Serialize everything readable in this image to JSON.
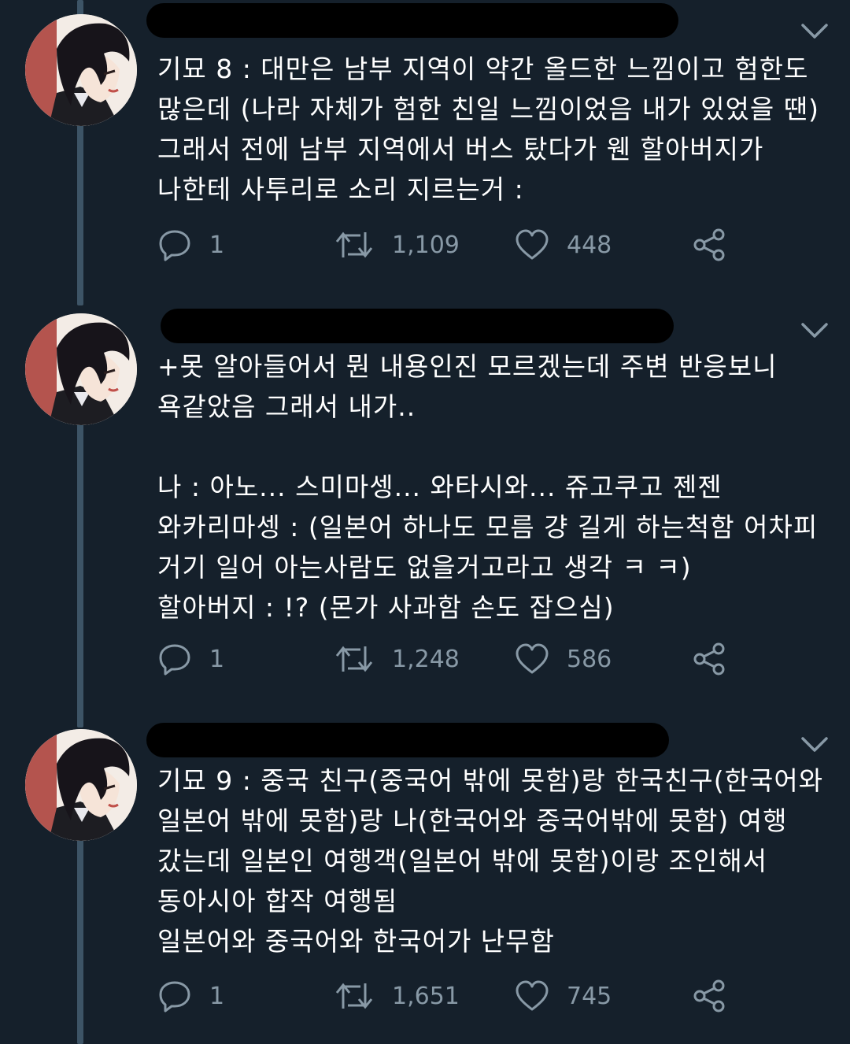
{
  "tweets": [
    {
      "text": "기묘 8 : 대만은 남부 지역이 약간 올드한 느낌이고 험한도\n많은데 (나라 자체가 험한 친일 느낌이었음 내가 있었을 땐)\n그래서 전에 남부 지역에서 버스 탔다가 웬 할아버지가\n나한테 사투리로 소리 지르는거 :",
      "replies": "1",
      "retweets": "1,109",
      "likes": "448"
    },
    {
      "text": "+못 알아들어서 뭔 내용인진 모르겠는데 주변 반응보니\n욕같았음 그래서 내가..\n\n나 : 아노... 스미마셍... 와타시와... 쥬고쿠고 젠젠\n와카리마셍 : (일본어 하나도 모름 걍 길게 하는척함 어차피\n거기 일어 아는사람도 없을거고라고 생각 ㅋ ㅋ)\n할아버지 : !? (몬가 사과함 손도 잡으심)",
      "replies": "1",
      "retweets": "1,248",
      "likes": "586"
    },
    {
      "text": "기묘 9 : 중국 친구(중국어 밖에 못함)랑 한국친구(한국어와\n일본어 밖에 못함)랑 나(한국어와 중국어밖에 못함) 여행\n갔는데 일본인 여행객(일본어 밖에 못함)이랑 조인해서\n동아시아 합작 여행됨\n일본어와 중국어와 한국어가 난무함",
      "replies": "1",
      "retweets": "1,651",
      "likes": "745"
    }
  ],
  "icons": {
    "reply": "speech-bubble-icon",
    "retweet": "retweet-arrows-icon",
    "like": "heart-icon",
    "share": "share-nodes-icon",
    "menu": "chevron-down-icon"
  },
  "colors": {
    "background": "#15202b",
    "text": "#ffffff",
    "muted": "#8899a6",
    "thread_line": "#3d5466",
    "redaction": "#000000"
  }
}
